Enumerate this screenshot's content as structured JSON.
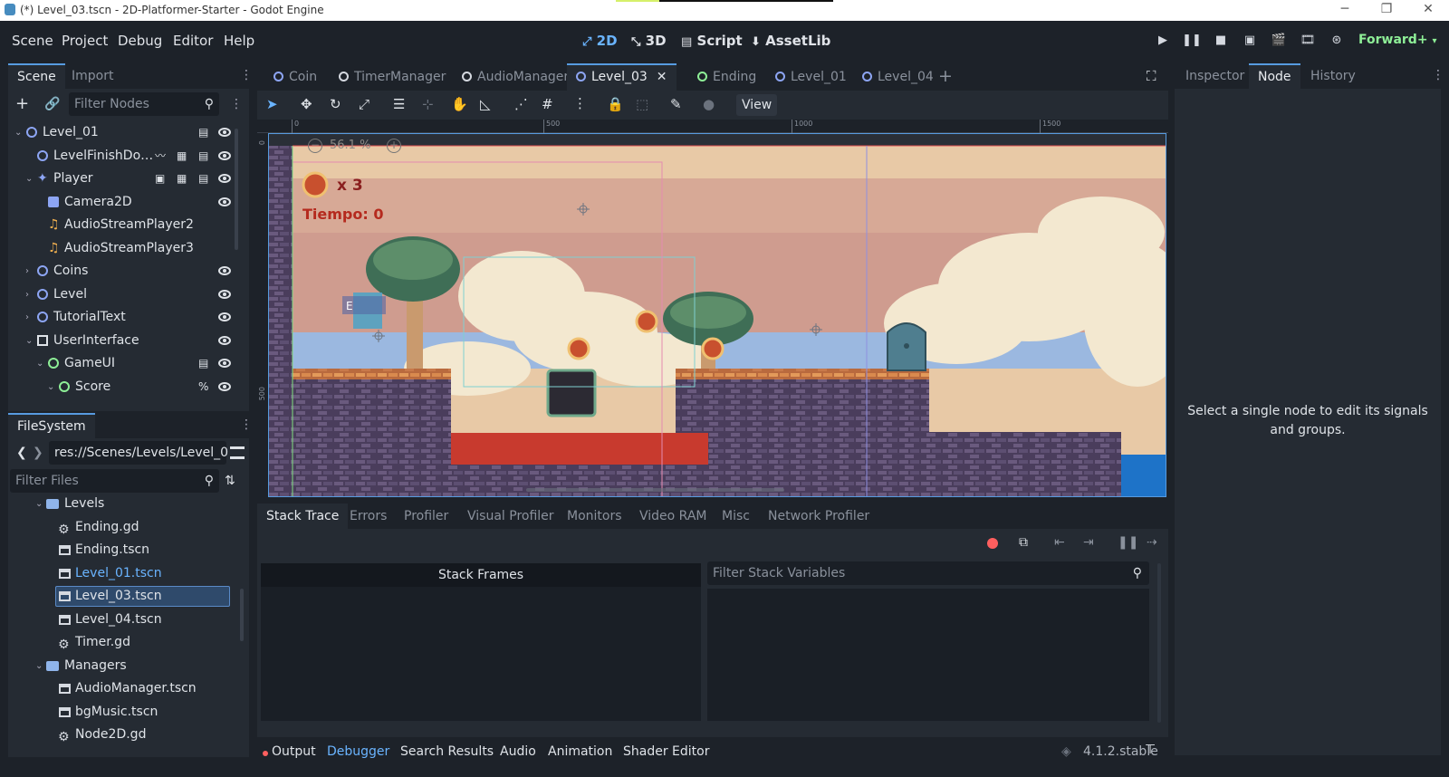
{
  "window": {
    "title": "(*) Level_03.tscn - 2D-Platformer-Starter - Godot Engine",
    "controls": [
      "─",
      "❐",
      "✕"
    ]
  },
  "menu": [
    "Scene",
    "Project",
    "Debug",
    "Editor",
    "Help"
  ],
  "workspaces": [
    {
      "label": "2D",
      "icon": "2d-icon",
      "active": true
    },
    {
      "label": "3D",
      "icon": "3d-icon",
      "active": false
    },
    {
      "label": "Script",
      "icon": "script-icon",
      "active": false
    },
    {
      "label": "AssetLib",
      "icon": "assetlib-icon",
      "active": false
    }
  ],
  "renderer": "Forward+",
  "scene_dock": {
    "tabs": [
      "Scene",
      "Import"
    ],
    "filter_placeholder": "Filter Nodes",
    "tree": [
      {
        "label": "Level_01",
        "depth": 0,
        "icon": "node2d-icon",
        "expanded": true,
        "badges": [
          "script-icon",
          "eye-icon"
        ]
      },
      {
        "label": "LevelFinishDo…",
        "depth": 1,
        "icon": "area2d-icon",
        "badges": [
          "signal-icon",
          "group-icon",
          "script-icon",
          "eye-icon"
        ]
      },
      {
        "label": "Player",
        "depth": 1,
        "icon": "character-icon",
        "expanded": true,
        "badges": [
          "instance-icon",
          "group-icon",
          "script-icon",
          "eye-icon"
        ]
      },
      {
        "label": "Camera2D",
        "depth": 2,
        "icon": "camera-icon",
        "badges": [
          "eye-icon"
        ]
      },
      {
        "label": "AudioStreamPlayer2",
        "depth": 2,
        "icon": "audio-icon",
        "badges": []
      },
      {
        "label": "AudioStreamPlayer3",
        "depth": 2,
        "icon": "audio-icon",
        "badges": []
      },
      {
        "label": "Coins",
        "depth": 1,
        "icon": "node2d-icon",
        "collapsed": true,
        "badges": [
          "eye-icon"
        ]
      },
      {
        "label": "Level",
        "depth": 1,
        "icon": "node2d-icon",
        "collapsed": true,
        "badges": [
          "eye-icon"
        ]
      },
      {
        "label": "TutorialText",
        "depth": 1,
        "icon": "node2d-icon",
        "collapsed": true,
        "badges": [
          "eye-icon"
        ]
      },
      {
        "label": "UserInterface",
        "depth": 1,
        "icon": "canvaslayer-icon",
        "expanded": true,
        "badges": [
          "eye-icon"
        ]
      },
      {
        "label": "GameUI",
        "depth": 2,
        "icon": "control-icon",
        "expanded": true,
        "badges": [
          "script-icon",
          "eye-icon"
        ]
      },
      {
        "label": "Score",
        "depth": 3,
        "icon": "control-icon",
        "expanded": true,
        "badges": [
          "percent-icon",
          "eye-icon"
        ]
      }
    ]
  },
  "filesystem": {
    "title": "FileSystem",
    "path": "res://Scenes/Levels/Level_0",
    "filter_placeholder": "Filter Files",
    "items": [
      {
        "label": "Levels",
        "type": "folder",
        "depth": 1
      },
      {
        "label": "Ending.gd",
        "type": "script",
        "depth": 2
      },
      {
        "label": "Ending.tscn",
        "type": "scene",
        "depth": 2
      },
      {
        "label": "Level_01.tscn",
        "type": "scene",
        "depth": 2,
        "highlight": true
      },
      {
        "label": "Level_03.tscn",
        "type": "scene",
        "depth": 2,
        "selected": true
      },
      {
        "label": "Level_04.tscn",
        "type": "scene",
        "depth": 2
      },
      {
        "label": "Timer.gd",
        "type": "script",
        "depth": 2
      },
      {
        "label": "Managers",
        "type": "folder",
        "depth": 1
      },
      {
        "label": "AudioManager.tscn",
        "type": "scene",
        "depth": 2
      },
      {
        "label": "bgMusic.tscn",
        "type": "scene",
        "depth": 2
      },
      {
        "label": "Node2D.gd",
        "type": "script",
        "depth": 2
      }
    ]
  },
  "scene_tabs": [
    {
      "label": "Coin",
      "color": "#8da5f3"
    },
    {
      "label": "TimerManager",
      "color": "#d5d9e0"
    },
    {
      "label": "AudioManager",
      "color": "#d5d9e0"
    },
    {
      "label": "Level_03",
      "color": "#8da5f3",
      "active": true
    },
    {
      "label": "Ending",
      "color": "#8eef97"
    },
    {
      "label": "Level_01",
      "color": "#8da5f3"
    },
    {
      "label": "Level_04",
      "color": "#8da5f3"
    }
  ],
  "toolbar": {
    "view_label": "View"
  },
  "canvas": {
    "zoom": "56.1 %",
    "ruler_marks": [
      "0",
      "500",
      "1000",
      "1500"
    ],
    "ruler_v_marks": [
      "0",
      "500"
    ],
    "hud_coins": "x 3",
    "hud_time": "Tiempo: 0",
    "player_label": "E"
  },
  "right_dock": {
    "tabs": [
      "Inspector",
      "Node",
      "History"
    ],
    "active_tab": "Node",
    "message": "Select a single node to edit its signals and groups."
  },
  "debugger": {
    "tabs": [
      "Stack Trace",
      "Errors",
      "Profiler",
      "Visual Profiler",
      "Monitors",
      "Video RAM",
      "Misc",
      "Network Profiler"
    ],
    "stack_frames_label": "Stack Frames",
    "filter_placeholder": "Filter Stack Variables"
  },
  "bottom_bar": {
    "items": [
      "Output",
      "Debugger",
      "Search Results",
      "Audio",
      "Animation",
      "Shader Editor"
    ],
    "active": "Debugger",
    "version": "4.1.2.stable"
  },
  "colors": {
    "accent": "#6ab4ff",
    "node_blue": "#8da5f3",
    "node_green": "#8eef97",
    "record_red": "#ff5f5f"
  }
}
